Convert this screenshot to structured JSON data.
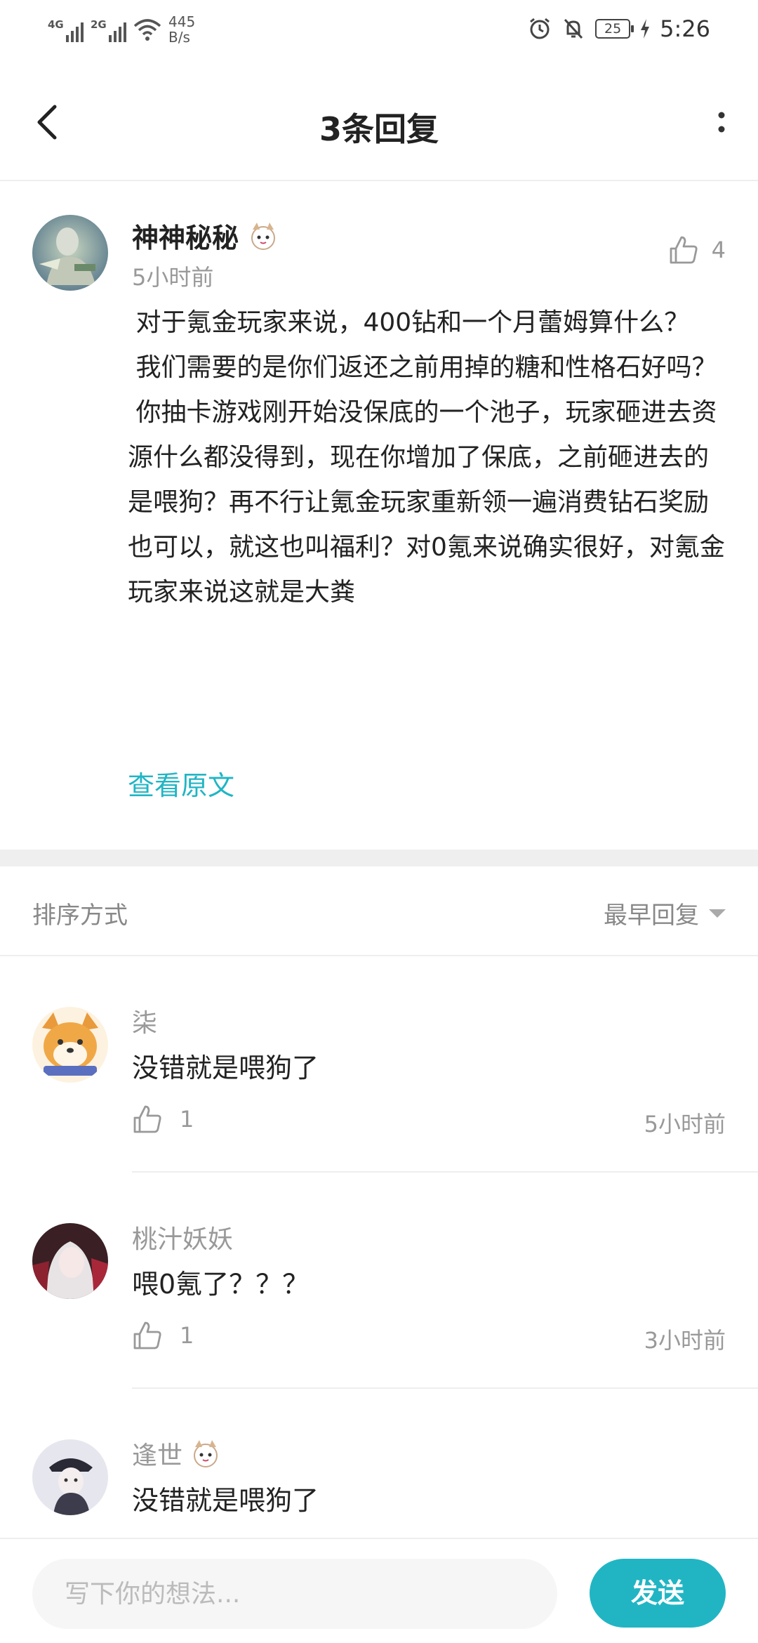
{
  "status_bar": {
    "net1": "4G",
    "net2": "2G",
    "speed_value": "445",
    "speed_unit": "B/s",
    "battery": "25",
    "time": "5:26"
  },
  "header": {
    "title": "3条回复",
    "back_icon": "chevron-left-icon",
    "more_icon": "more-vertical-icon"
  },
  "main_comment": {
    "author": "神神秘秘",
    "time": "5小时前",
    "likes": "4",
    "body": " 对于氪金玩家来说，400钻和一个月蕾姆算什么？\n 我们需要的是你们返还之前用掉的糖和性格石好吗？\n 你抽卡游戏刚开始没保底的一个池子，玩家砸进去资源什么都没得到，现在你增加了保底，之前砸进去的是喂狗？再不行让氪金玩家重新领一遍消费钻石奖励也可以，就这也叫福利？对0氪来说确实很好，对氪金玩家来说这就是大粪",
    "view_original": "查看原文"
  },
  "sort": {
    "label": "排序方式",
    "selected": "最早回复"
  },
  "replies": [
    {
      "author": "柒",
      "text": "没错就是喂狗了",
      "likes": "1",
      "time": "5小时前"
    },
    {
      "author": "桃汁妖妖",
      "text": "喂0氪了？？？",
      "likes": "1",
      "time": "3小时前"
    },
    {
      "author": "逢世",
      "text": "没错就是喂狗了"
    }
  ],
  "input": {
    "placeholder": "写下你的想法...",
    "send_label": "发送"
  },
  "colors": {
    "accent": "#21b5c4",
    "muted_text": "#999999",
    "body_text": "#222222"
  }
}
